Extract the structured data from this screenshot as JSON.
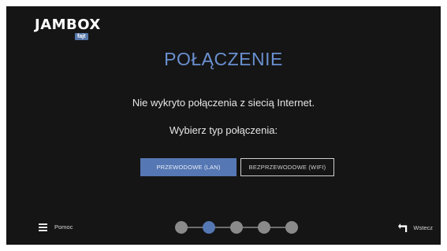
{
  "logo": {
    "text": "JAMBOX",
    "badge": "fajt"
  },
  "title": "POŁĄCZENIE",
  "message": "Nie wykryto połączenia z siecią Internet.",
  "prompt": "Wybierz typ połączenia:",
  "buttons": {
    "wired": "PRZEWODOWE (LAN)",
    "wireless": "BEZPRZEWODOWE (WIFI)"
  },
  "footer": {
    "help_label": "Pomoc",
    "back_label": "Wstecz"
  },
  "progress": {
    "total_steps": 5,
    "current_step": 2
  },
  "colors": {
    "accent": "#5577b3",
    "title": "#6a8fcf",
    "step_inactive": "#8a8a8a",
    "step_active": "#5577b3",
    "background": "#151515"
  },
  "icons": {
    "help": "menu-icon",
    "back": "back-arrow-icon"
  }
}
